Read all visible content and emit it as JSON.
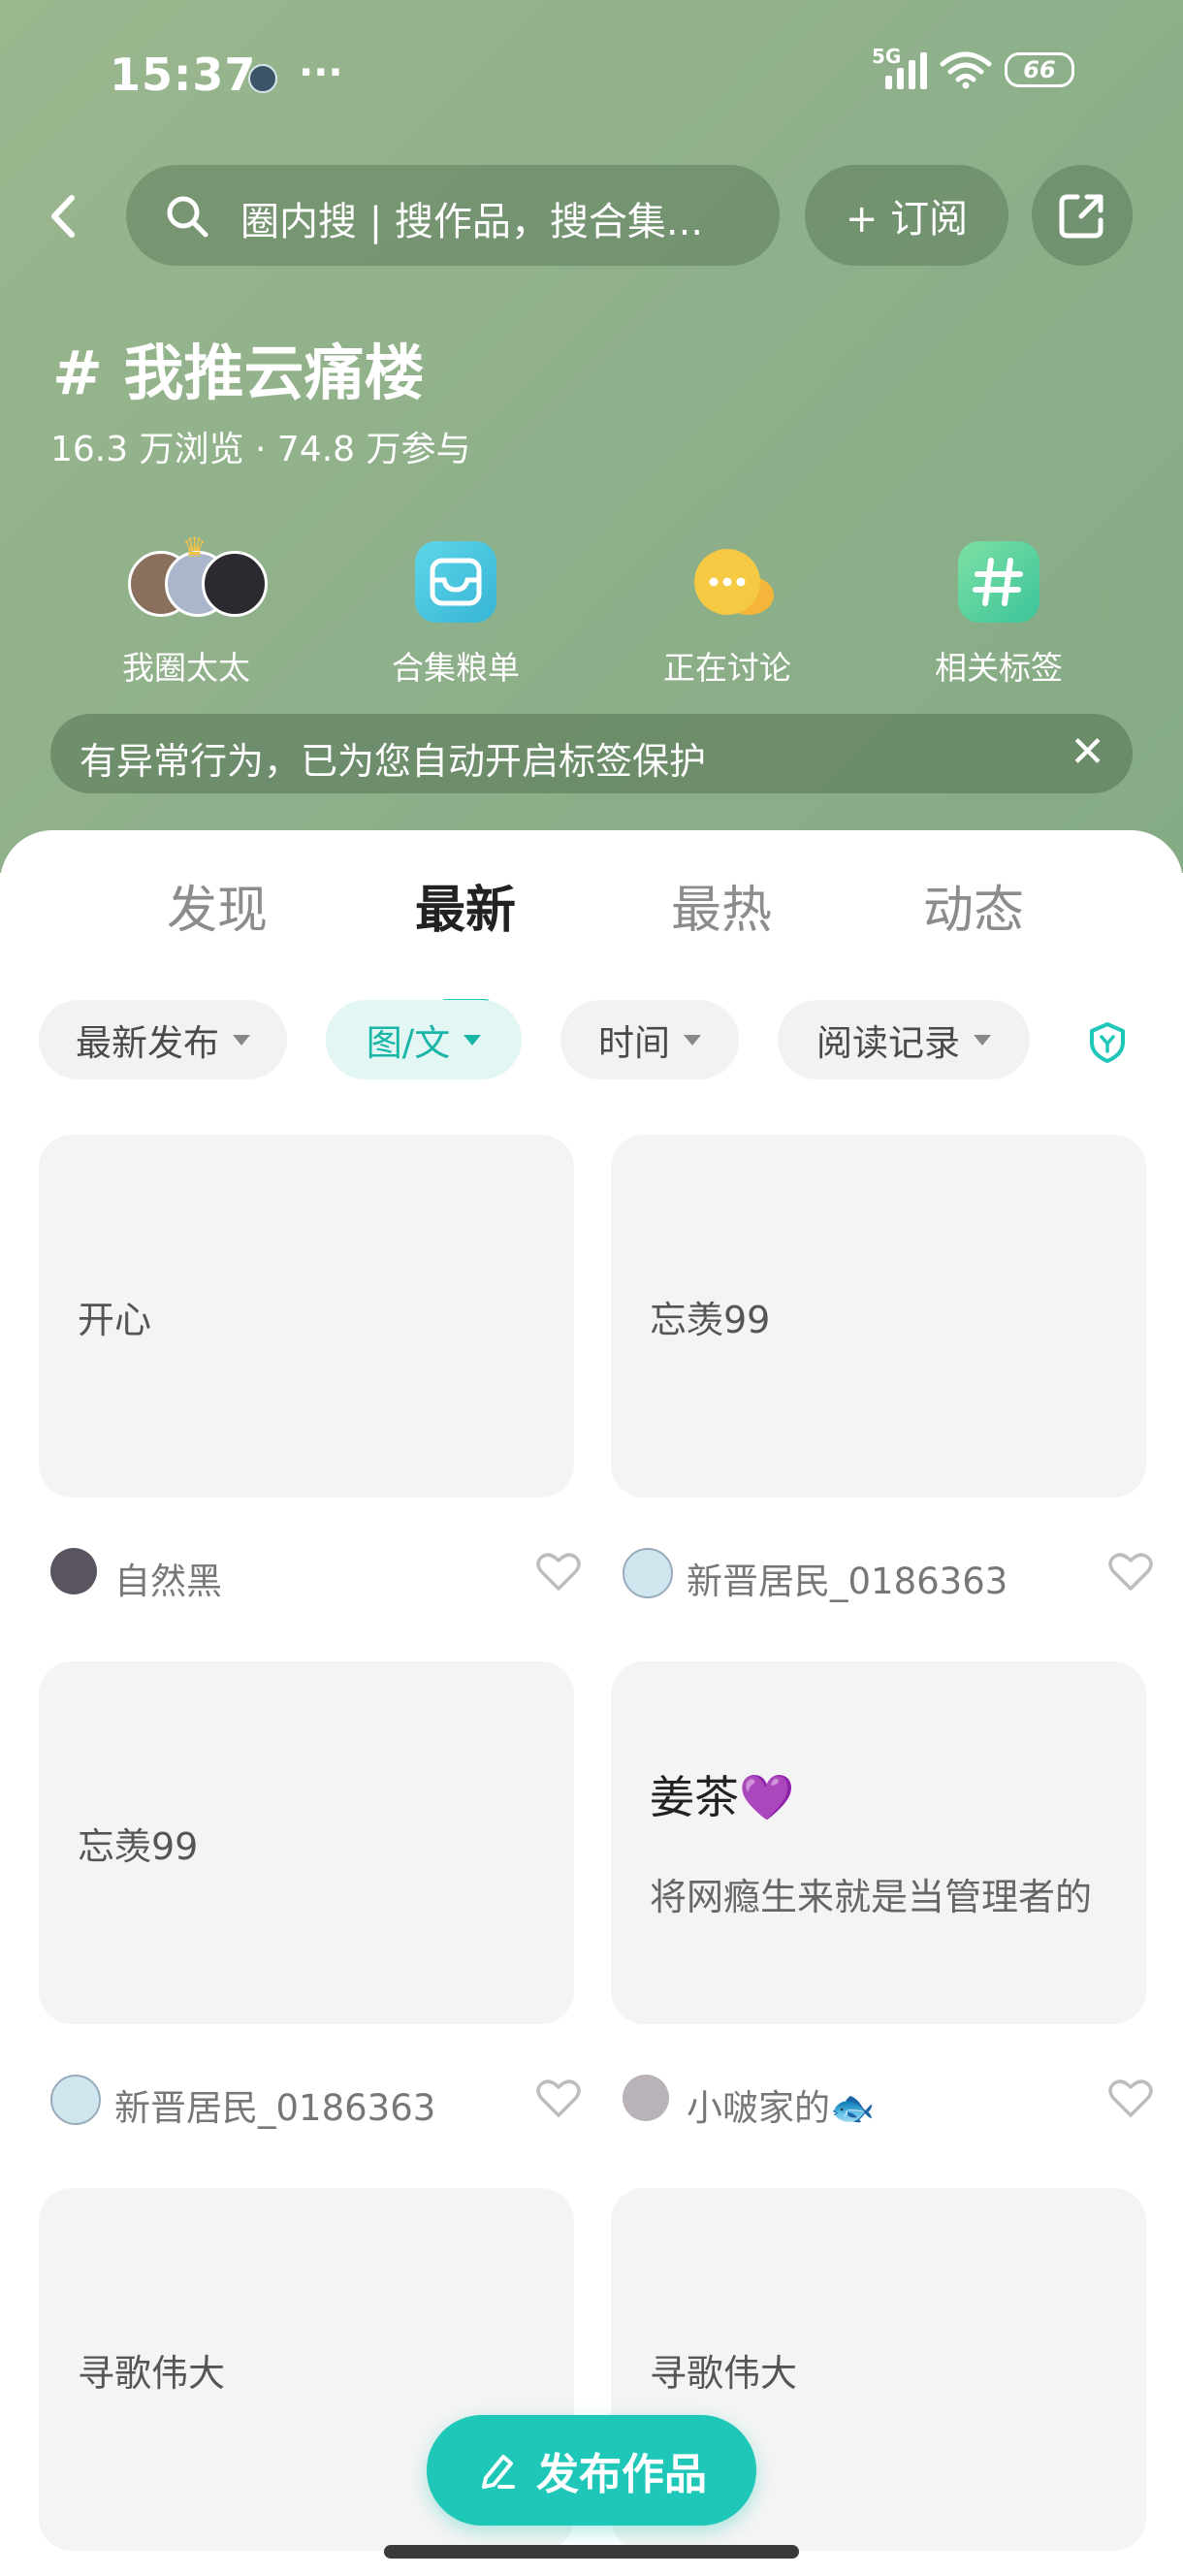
{
  "status_bar": {
    "time": "15:37",
    "dots": "···",
    "network": "5G",
    "battery": "66"
  },
  "nav": {
    "search_placeholder": "圈内搜 | 搜作品，搜合集...",
    "subscribe_label": "+ 订阅"
  },
  "topic": {
    "title": "# 我推云痛楼",
    "stats": "16.3 万浏览 · 74.8 万参与"
  },
  "quick_links": [
    {
      "label": "我圈太太",
      "icon": "avatars-icon"
    },
    {
      "label": "合集粮单",
      "icon": "collection-icon"
    },
    {
      "label": "正在讨论",
      "icon": "chat-icon"
    },
    {
      "label": "相关标签",
      "icon": "hashtag-icon"
    }
  ],
  "notice": {
    "text": "检测到有异常行为，已为您自动开启标签保护",
    "visible_text": "有异常行为，已为您自动开启标签保护"
  },
  "tabs": [
    {
      "label": "发现",
      "active": false
    },
    {
      "label": "最新",
      "active": true
    },
    {
      "label": "最热",
      "active": false
    },
    {
      "label": "动态",
      "active": false
    }
  ],
  "filters": [
    {
      "label": "最新发布",
      "active": false
    },
    {
      "label": "图/文",
      "active": true
    },
    {
      "label": "时间",
      "active": false
    },
    {
      "label": "阅读记录",
      "active": false
    }
  ],
  "cards": [
    {
      "title": "开心",
      "author": "自然黑",
      "avatar_color": "#5a5360"
    },
    {
      "title": "忘羡99",
      "author": "新晋居民_0186363",
      "avatar_color": "#cfe6ee"
    },
    {
      "title": "忘羡99",
      "author": "新晋居民_0186363",
      "avatar_color": "#cfe6ee"
    },
    {
      "head": "姜茶💜",
      "body": "将网瘾生来就是当管理者的",
      "author": "小啵家的🐟",
      "avatar_color": "#b9b2b8"
    },
    {
      "title": "寻歌伟大",
      "author": "",
      "avatar_color": ""
    },
    {
      "title": "寻歌伟大",
      "author": "",
      "avatar_color": ""
    }
  ],
  "publish_button": {
    "label": "发布作品"
  },
  "colors": {
    "accent": "#1ec7b7",
    "hero_green": "#8eb08a"
  }
}
